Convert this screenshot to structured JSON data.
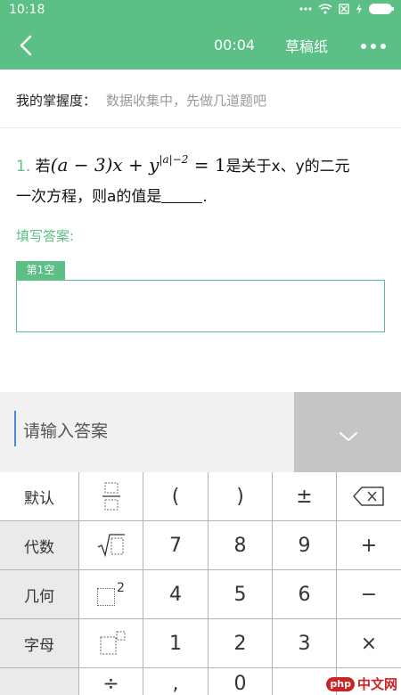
{
  "status": {
    "time": "10:18"
  },
  "header": {
    "timer": "00:04",
    "draft_label": "草稿纸"
  },
  "mastery": {
    "label": "我的掌握度：",
    "value": "数据收集中，先做几道题吧"
  },
  "question": {
    "number": "1.",
    "prefix": "若",
    "eq_left": "(a − 3)x + y",
    "eq_exp": "|a|−2",
    "eq_right": " = 1",
    "after_eq": "是关于x、y的二元",
    "line2": "一次方程，则a的值是",
    "end": "."
  },
  "answer": {
    "label": "填写答案:",
    "blank_tag": "第1空"
  },
  "input": {
    "placeholder": "请输入答案"
  },
  "keyboard": {
    "default_label": "默认",
    "algebra_label": "代数",
    "geometry_label": "几何",
    "letters_label": "字母",
    "keys": {
      "lparen": "(",
      "rparen": ")",
      "plusminus": "±",
      "seven": "7",
      "eight": "8",
      "nine": "9",
      "plus": "+",
      "four": "4",
      "five": "5",
      "six": "6",
      "minus": "−",
      "one": "1",
      "two": "2",
      "three": "3",
      "times": "×",
      "divide": "÷",
      "comma": ",",
      "zero": "0",
      "power_exp": "2"
    }
  },
  "watermark": {
    "logo": "php",
    "text": "中文网"
  },
  "colors": {
    "accent": "#5cbf86",
    "cursor": "#4a88e0"
  }
}
